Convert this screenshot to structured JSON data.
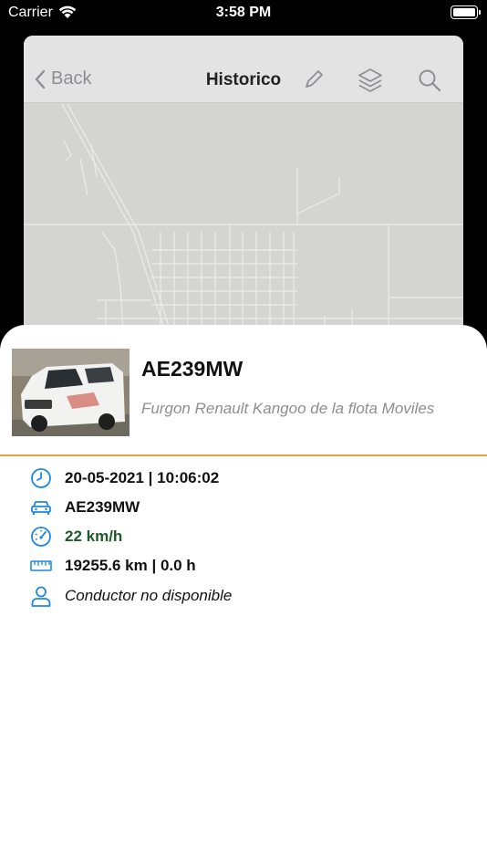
{
  "status_bar": {
    "carrier": "Carrier",
    "time": "3:58 PM"
  },
  "nav": {
    "back_label": "Back",
    "title": "Historico"
  },
  "vehicle": {
    "plate": "AE239MW",
    "description": "Furgon Renault Kangoo de la flota Moviles"
  },
  "details": {
    "datetime": "20-05-2021 | 10:06:02",
    "plate": "AE239MW",
    "speed": "22 km/h",
    "distance_hours": "19255.6 km | 0.0 h",
    "driver": "Conductor no disponible"
  },
  "colors": {
    "accent": "#1e88e5",
    "divider": "#f0a040",
    "speed_text": "#1c5a2a"
  },
  "icons": [
    "wifi-icon",
    "battery-icon",
    "chevron-left-icon",
    "pencil-icon",
    "layers-icon",
    "search-icon",
    "clock-icon",
    "car-icon",
    "speedometer-icon",
    "ruler-icon",
    "person-icon"
  ]
}
